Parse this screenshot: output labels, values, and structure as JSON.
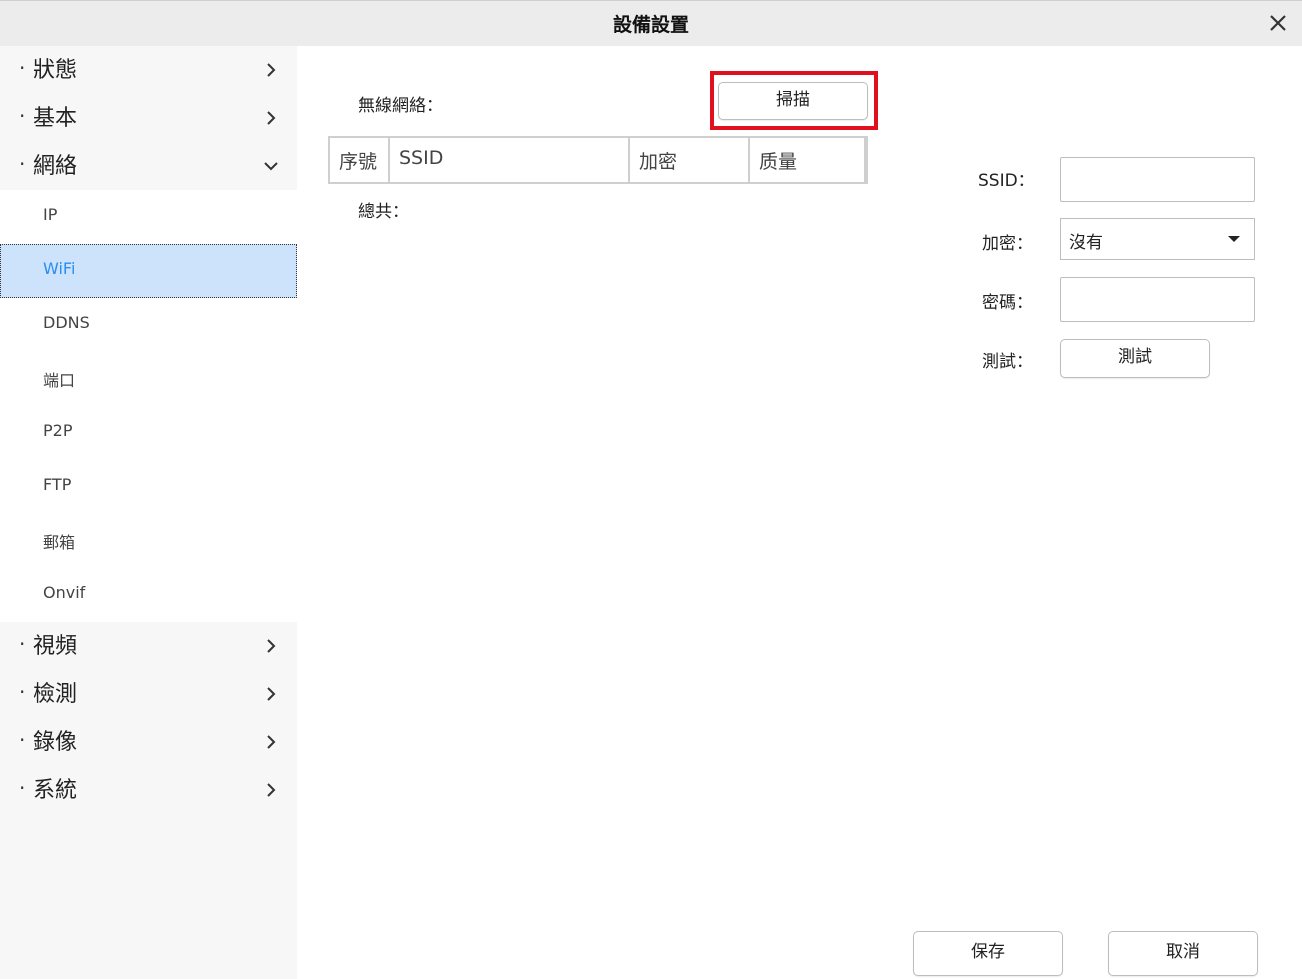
{
  "window": {
    "title": "設備設置",
    "close_icon": "close-icon"
  },
  "sidebar": {
    "sections": [
      {
        "label": "狀態",
        "bullet": "·",
        "expanded": false
      },
      {
        "label": "基本",
        "bullet": "·",
        "expanded": false
      },
      {
        "label": "網絡",
        "bullet": "·",
        "expanded": true
      },
      {
        "label": "視頻",
        "bullet": "·",
        "expanded": false
      },
      {
        "label": "檢測",
        "bullet": "·",
        "expanded": false
      },
      {
        "label": "錄像",
        "bullet": "·",
        "expanded": false
      },
      {
        "label": "系統",
        "bullet": "·",
        "expanded": false
      }
    ],
    "network_items": [
      {
        "label": "IP"
      },
      {
        "label": "WiFi",
        "selected": true
      },
      {
        "label": "DDNS"
      },
      {
        "label": "端口"
      },
      {
        "label": "P2P"
      },
      {
        "label": "FTP"
      },
      {
        "label": "郵箱"
      },
      {
        "label": "Onvif"
      }
    ],
    "selected_color": "#2b8ef0"
  },
  "wifi": {
    "network_label": "無線網絡：",
    "scan_button": "掃描",
    "table_headers": [
      "序號",
      "SSID",
      "加密",
      "质量"
    ],
    "total_label": "總共：",
    "ssid_label": "SSID：",
    "ssid_value": "",
    "encryption_label": "加密：",
    "encryption_value": "沒有",
    "password_label": "密碼：",
    "password_value": "",
    "test_label": "測試：",
    "test_button": "測試",
    "highlight_color": "#e0101e"
  },
  "footer": {
    "save_button": "保存",
    "cancel_button": "取消"
  }
}
